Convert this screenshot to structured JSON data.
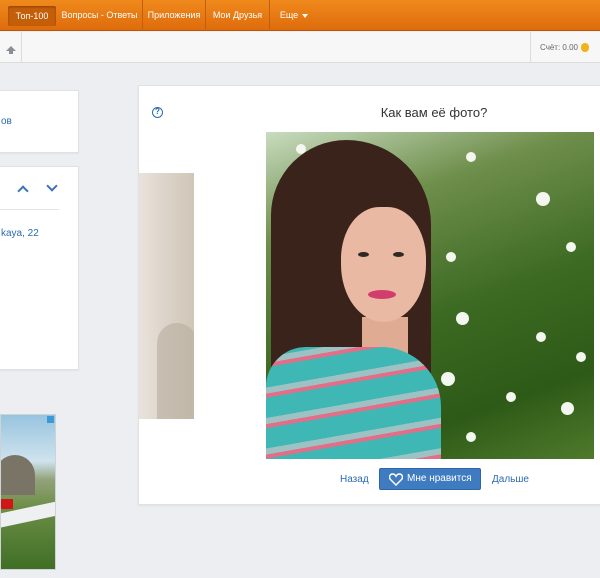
{
  "topnav": {
    "items": [
      {
        "label": "Топ-100",
        "active": true
      },
      {
        "label": "Вопросы - Ответы",
        "active": false
      },
      {
        "label": "Приложения",
        "active": false
      },
      {
        "label": "Мои Друзья",
        "active": false
      },
      {
        "label": "Еще",
        "active": false
      }
    ]
  },
  "subbar": {
    "score_label": "Счёт: 0.00"
  },
  "left": {
    "panel1_link": "ов",
    "panel2_address": "kaya, 22"
  },
  "main": {
    "question": "Как вам её фото?",
    "help_glyph": "?",
    "back_label": "Назад",
    "like_label": "Мне нравится",
    "next_label": "Дальше"
  },
  "colors": {
    "nav_orange": "#e97a12",
    "link_blue": "#2c6ab0",
    "button_blue": "#3f7bc1"
  }
}
